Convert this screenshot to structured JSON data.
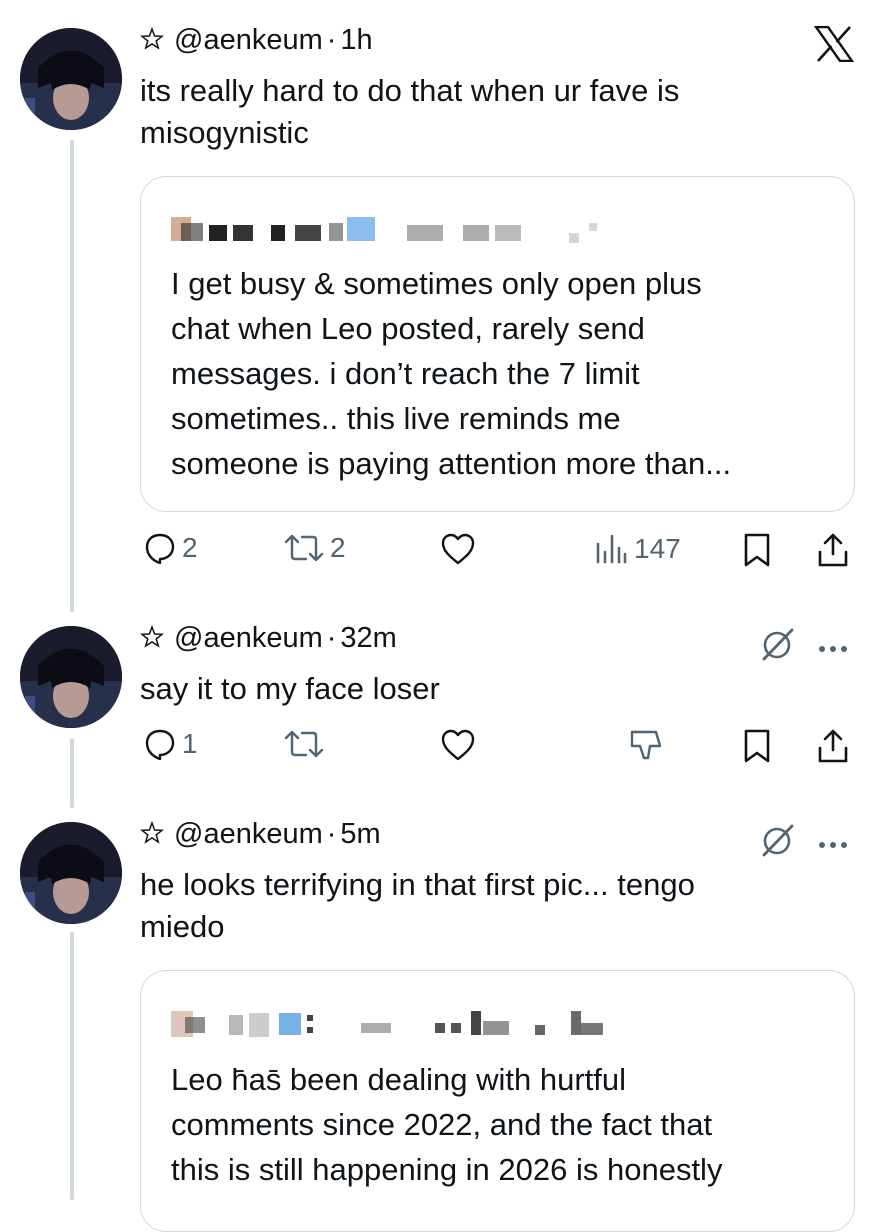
{
  "posts": [
    {
      "handle": "@aenkeum",
      "separator": "·",
      "time": "1h",
      "text": "its really hard to do that when ur fave is\nmisogynistic",
      "quote": {
        "text": "I get busy & sometimes only open plus\nchat when Leo posted, rarely send\nmessages. i don’t reach the 7 limit\nsometimes.. this live reminds me\nsomeone is paying attention more than..."
      },
      "actions": {
        "replies": "2",
        "reposts": "2",
        "views": "147"
      },
      "corner_icon": "x-logo-icon"
    },
    {
      "handle": "@aenkeum",
      "separator": "·",
      "time": "32m",
      "text": "say it to my face loser",
      "actions": {
        "replies": "1"
      },
      "corner_icons": [
        "grok-icon",
        "more-icon"
      ]
    },
    {
      "handle": "@aenkeum",
      "separator": "·",
      "time": "5m",
      "text": "he looks terrifying in that first pic... tengo\nmiedo",
      "quote": {
        "text": "Leo h̄as̄ been dealing with hurtful\ncomments since 2022, and the fact that\nthis is still happening in 2026 is honestly"
      },
      "corner_icons": [
        "grok-icon",
        "more-icon"
      ]
    }
  ],
  "colors": {
    "text": "#0f1419",
    "muted": "#536471",
    "border": "#cfd9de"
  }
}
